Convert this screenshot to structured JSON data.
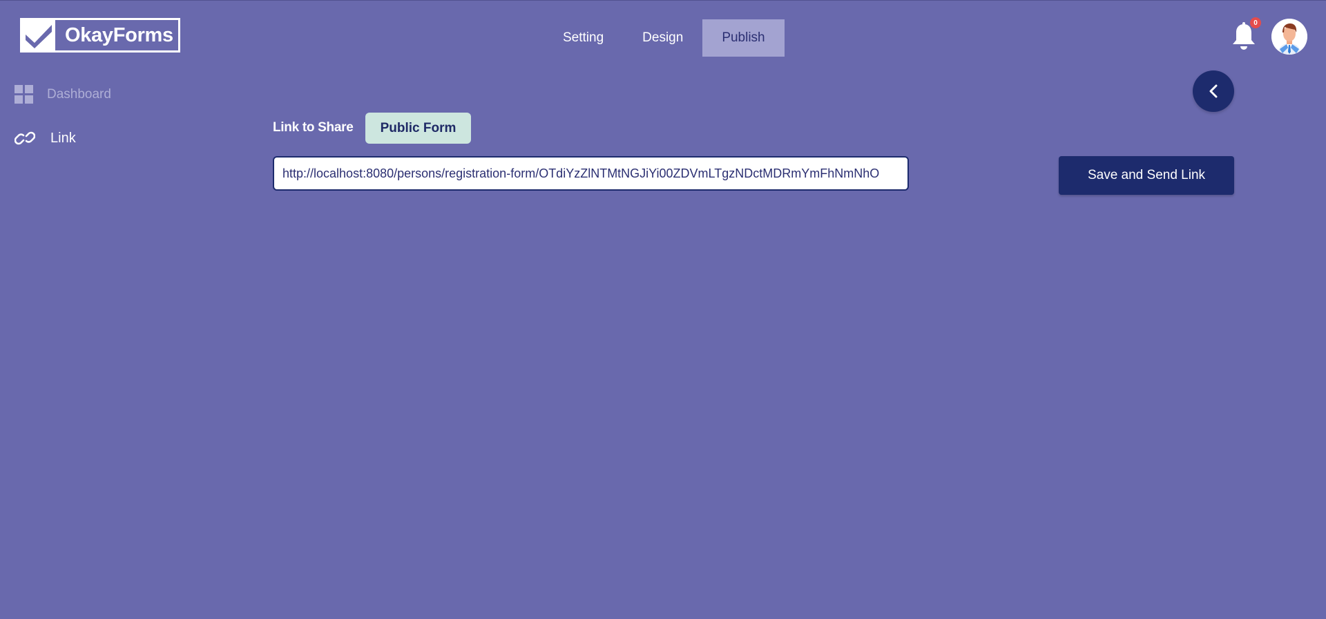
{
  "brand": {
    "name": "OkayForms"
  },
  "topnav": {
    "tabs": [
      {
        "label": "Setting",
        "active": false
      },
      {
        "label": "Design",
        "active": false
      },
      {
        "label": "Publish",
        "active": true
      }
    ]
  },
  "header": {
    "notification_count": "0",
    "icons": {
      "bell": "bell-icon",
      "avatar": "user-avatar"
    }
  },
  "sidebar": {
    "items": [
      {
        "label": "Dashboard",
        "icon": "dashboard-grid-icon"
      },
      {
        "label": "Link",
        "icon": "link-icon"
      }
    ]
  },
  "main": {
    "share_label": "Link to Share",
    "public_form_button": "Public Form",
    "url_value": "http://localhost:8080/persons/registration-form/OTdiYzZlNTMtNGJiYi00ZDVmLTgzNDctMDRmYmFhNmNhO",
    "save_button": "Save and Send Link",
    "back_icon": "chevron-left-icon"
  },
  "colors": {
    "background": "#6969ad",
    "primary_dark": "#1d2b6d",
    "active_tab": "#a3a3d1",
    "public_form_bg": "#cde6df",
    "badge": "#e54c4c"
  }
}
